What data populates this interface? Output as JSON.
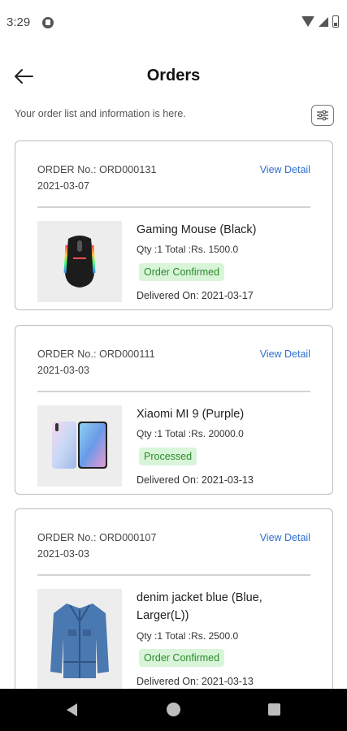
{
  "status_bar": {
    "time": "3:29"
  },
  "header": {
    "title": "Orders"
  },
  "subtitle": "Your order list and information is here.",
  "orders": [
    {
      "order_no": "ORDER No.: ORD000131",
      "date": "2021-03-07",
      "view_detail": "View Detail",
      "product": "Gaming Mouse (Black)",
      "qty_total": "Qty :1  Total :Rs. 1500.0",
      "status": "Order Confirmed",
      "delivered": "Delivered On: 2021-03-17",
      "image": "gaming-mouse"
    },
    {
      "order_no": "ORDER No.: ORD000111",
      "date": "2021-03-03",
      "view_detail": "View Detail",
      "product": "Xiaomi MI 9 (Purple)",
      "qty_total": "Qty :1  Total :Rs. 20000.0",
      "status": "Processed",
      "delivered": "Delivered On: 2021-03-13",
      "image": "phone"
    },
    {
      "order_no": "ORDER No.: ORD000107",
      "date": "2021-03-03",
      "view_detail": "View Detail",
      "product": "denim jacket blue (Blue, Larger(L))",
      "qty_total": "Qty :1  Total :Rs. 2500.0",
      "status": "Order Confirmed",
      "delivered": "Delivered On: 2021-03-13",
      "image": "denim-jacket"
    }
  ],
  "colors": {
    "accent": "#2f6fd0",
    "badge_bg": "#d9f5d9",
    "badge_text": "#2a8a2a"
  }
}
